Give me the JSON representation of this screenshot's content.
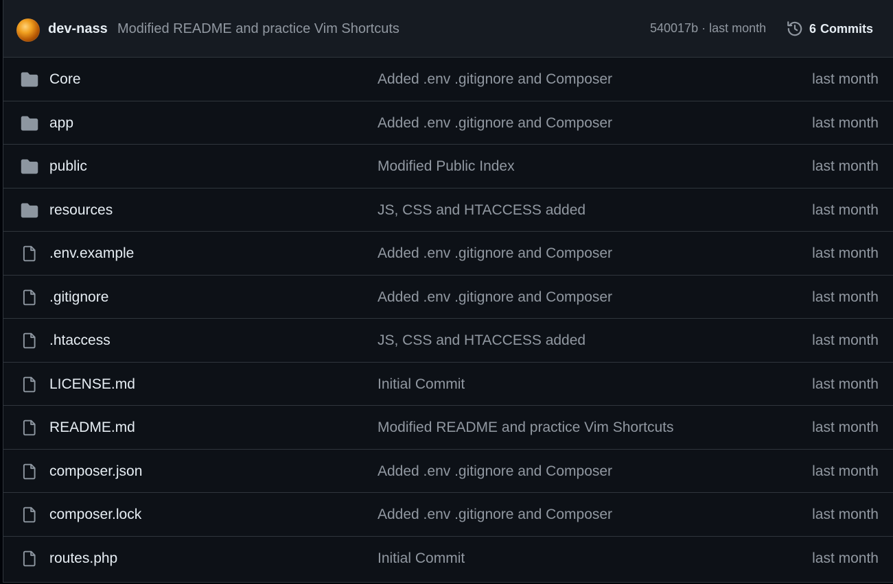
{
  "latest_commit": {
    "author": "dev-nass",
    "message": "Modified README and practice Vim Shortcuts",
    "hash": "540017b",
    "separator": "·",
    "time": "last month",
    "commits_count": "6",
    "commits_label": "Commits",
    "history_icon": "history-icon"
  },
  "colors": {
    "background": "#0d1117",
    "header_background": "#161b22",
    "border": "#30363d",
    "text_primary": "#e6edf3",
    "text_muted": "#9198a1",
    "icon": "#8d96a0"
  },
  "files": [
    {
      "type": "folder",
      "icon": "folder-icon",
      "name": "Core",
      "message": "Added .env .gitignore and Composer",
      "date": "last month"
    },
    {
      "type": "folder",
      "icon": "folder-icon",
      "name": "app",
      "message": "Added .env .gitignore and Composer",
      "date": "last month"
    },
    {
      "type": "folder",
      "icon": "folder-icon",
      "name": "public",
      "message": "Modified Public Index",
      "date": "last month"
    },
    {
      "type": "folder",
      "icon": "folder-icon",
      "name": "resources",
      "message": "JS, CSS and HTACCESS added",
      "date": "last month"
    },
    {
      "type": "file",
      "icon": "file-icon",
      "name": ".env.example",
      "message": "Added .env .gitignore and Composer",
      "date": "last month"
    },
    {
      "type": "file",
      "icon": "file-icon",
      "name": ".gitignore",
      "message": "Added .env .gitignore and Composer",
      "date": "last month"
    },
    {
      "type": "file",
      "icon": "file-icon",
      "name": ".htaccess",
      "message": "JS, CSS and HTACCESS added",
      "date": "last month"
    },
    {
      "type": "file",
      "icon": "file-icon",
      "name": "LICENSE.md",
      "message": "Initial Commit",
      "date": "last month"
    },
    {
      "type": "file",
      "icon": "file-icon",
      "name": "README.md",
      "message": "Modified README and practice Vim Shortcuts",
      "date": "last month"
    },
    {
      "type": "file",
      "icon": "file-icon",
      "name": "composer.json",
      "message": "Added .env .gitignore and Composer",
      "date": "last month"
    },
    {
      "type": "file",
      "icon": "file-icon",
      "name": "composer.lock",
      "message": "Added .env .gitignore and Composer",
      "date": "last month"
    },
    {
      "type": "file",
      "icon": "file-icon",
      "name": "routes.php",
      "message": "Initial Commit",
      "date": "last month"
    }
  ]
}
